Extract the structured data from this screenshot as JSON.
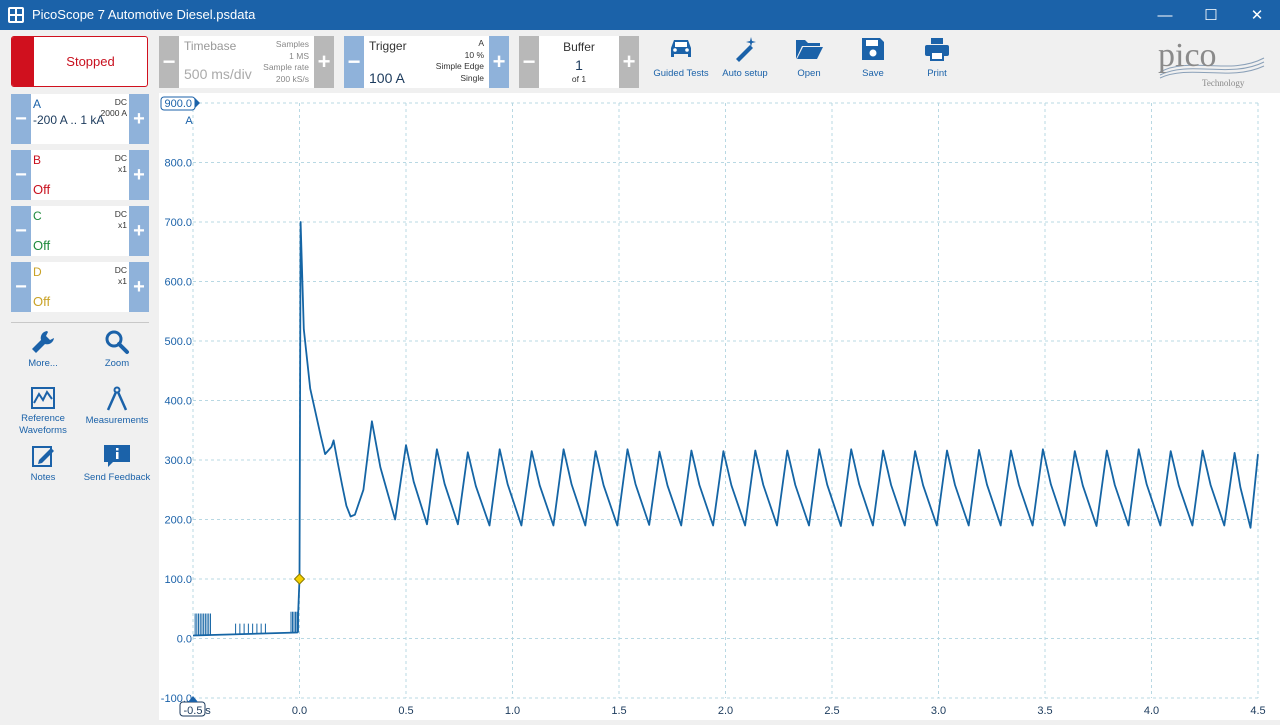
{
  "window": {
    "title": "PicoScope 7 Automotive Diesel.psdata",
    "minimize": "—",
    "maximize": "☐",
    "close": "✕"
  },
  "toolbar": {
    "run_state": "Stopped",
    "timebase": {
      "label": "Timebase",
      "value": "500 ms/div",
      "samples_label": "Samples",
      "samples_value": "1 MS",
      "rate_label": "Sample rate",
      "rate_value": "200 kS/s"
    },
    "trigger": {
      "label": "Trigger",
      "value": "100 A",
      "channel": "A",
      "pre": "10 %",
      "type": "Simple Edge",
      "mode": "Single"
    },
    "buffer": {
      "label": "Buffer",
      "value": "1",
      "of": "of 1"
    },
    "buttons": [
      "Guided Tests",
      "Auto setup",
      "Open",
      "Save",
      "Print"
    ],
    "logo": {
      "name": "pico",
      "sub": "Technology"
    }
  },
  "channels": [
    {
      "name": "A",
      "coupling": "DC",
      "extra": "2000 A",
      "range": "-200 A .. 1 kA",
      "color": "#1b62a9"
    },
    {
      "name": "B",
      "coupling": "DC",
      "extra": "x1",
      "state": "Off",
      "color": "#c8101e"
    },
    {
      "name": "C",
      "coupling": "DC",
      "extra": "x1",
      "state": "Off",
      "color": "#1e8a3c"
    },
    {
      "name": "D",
      "coupling": "DC",
      "extra": "x1",
      "state": "Off",
      "color": "#c9a227"
    }
  ],
  "side_tools": [
    {
      "label": "More...",
      "icon": "wrench-icon"
    },
    {
      "label": "Zoom",
      "icon": "magnifier-icon"
    },
    {
      "label": "Reference Waveforms",
      "icon": "reference-waveform-icon"
    },
    {
      "label": "Measurements",
      "icon": "caliper-icon"
    },
    {
      "label": "Notes",
      "icon": "notes-icon"
    },
    {
      "label": "Send Feedback",
      "icon": "feedback-icon"
    }
  ],
  "colors": {
    "accent": "#1b62a9",
    "trace": "#1565a5",
    "grid": "#b8d8e3",
    "stop": "#d0101e"
  },
  "chart_data": {
    "type": "line",
    "title": "",
    "xlabel": "s",
    "ylabel": "A",
    "xlim": [
      -0.5,
      4.5
    ],
    "ylim": [
      -100,
      900
    ],
    "x_ticks": [
      "-0.5",
      "0.0",
      "0.5",
      "1.0",
      "1.5",
      "2.0",
      "2.5",
      "3.0",
      "3.5",
      "4.0",
      "4.5"
    ],
    "y_ticks": [
      "-100.0",
      "0.0",
      "100.0",
      "200.0",
      "300.0",
      "400.0",
      "500.0",
      "600.0",
      "700.0",
      "800.0",
      "900.0"
    ],
    "grid": true,
    "trigger_marker": {
      "x": 0.0,
      "y": 100
    },
    "series": [
      {
        "name": "A",
        "peak_times": [
          0.34,
          0.5,
          0.645,
          0.79,
          0.94,
          1.09,
          1.24,
          1.39,
          1.54,
          1.69,
          1.84,
          1.99,
          2.14,
          2.29,
          2.44,
          2.59,
          2.74,
          2.89,
          3.04,
          3.19,
          3.34,
          3.49,
          3.64,
          3.79,
          3.94,
          4.09,
          4.24,
          4.39
        ],
        "peak_values": [
          365,
          325,
          318,
          313,
          318,
          315,
          318,
          315,
          318,
          314,
          316,
          315,
          316,
          316,
          318,
          318,
          316,
          315,
          316,
          317,
          316,
          318,
          315,
          316,
          318,
          315,
          316,
          312
        ],
        "trough_values": [
          200,
          192,
          192,
          190,
          190,
          190,
          190,
          190,
          191,
          190,
          190,
          190,
          190,
          190,
          189,
          190,
          190,
          190,
          190,
          190,
          190,
          190,
          189,
          190,
          190,
          190,
          190,
          186
        ],
        "prefix": [
          [
            -0.5,
            5
          ],
          [
            -0.01,
            10
          ],
          [
            0.0,
            100
          ],
          [
            0.005,
            700
          ],
          [
            0.02,
            520
          ],
          [
            0.05,
            420
          ],
          [
            0.1,
            340
          ],
          [
            0.12,
            310
          ],
          [
            0.15,
            322
          ],
          [
            0.16,
            333
          ],
          [
            0.18,
            295
          ],
          [
            0.2,
            258
          ],
          [
            0.22,
            223
          ],
          [
            0.24,
            205
          ],
          [
            0.26,
            208
          ],
          [
            0.3,
            250
          ],
          [
            0.34,
            365
          ]
        ]
      }
    ]
  }
}
